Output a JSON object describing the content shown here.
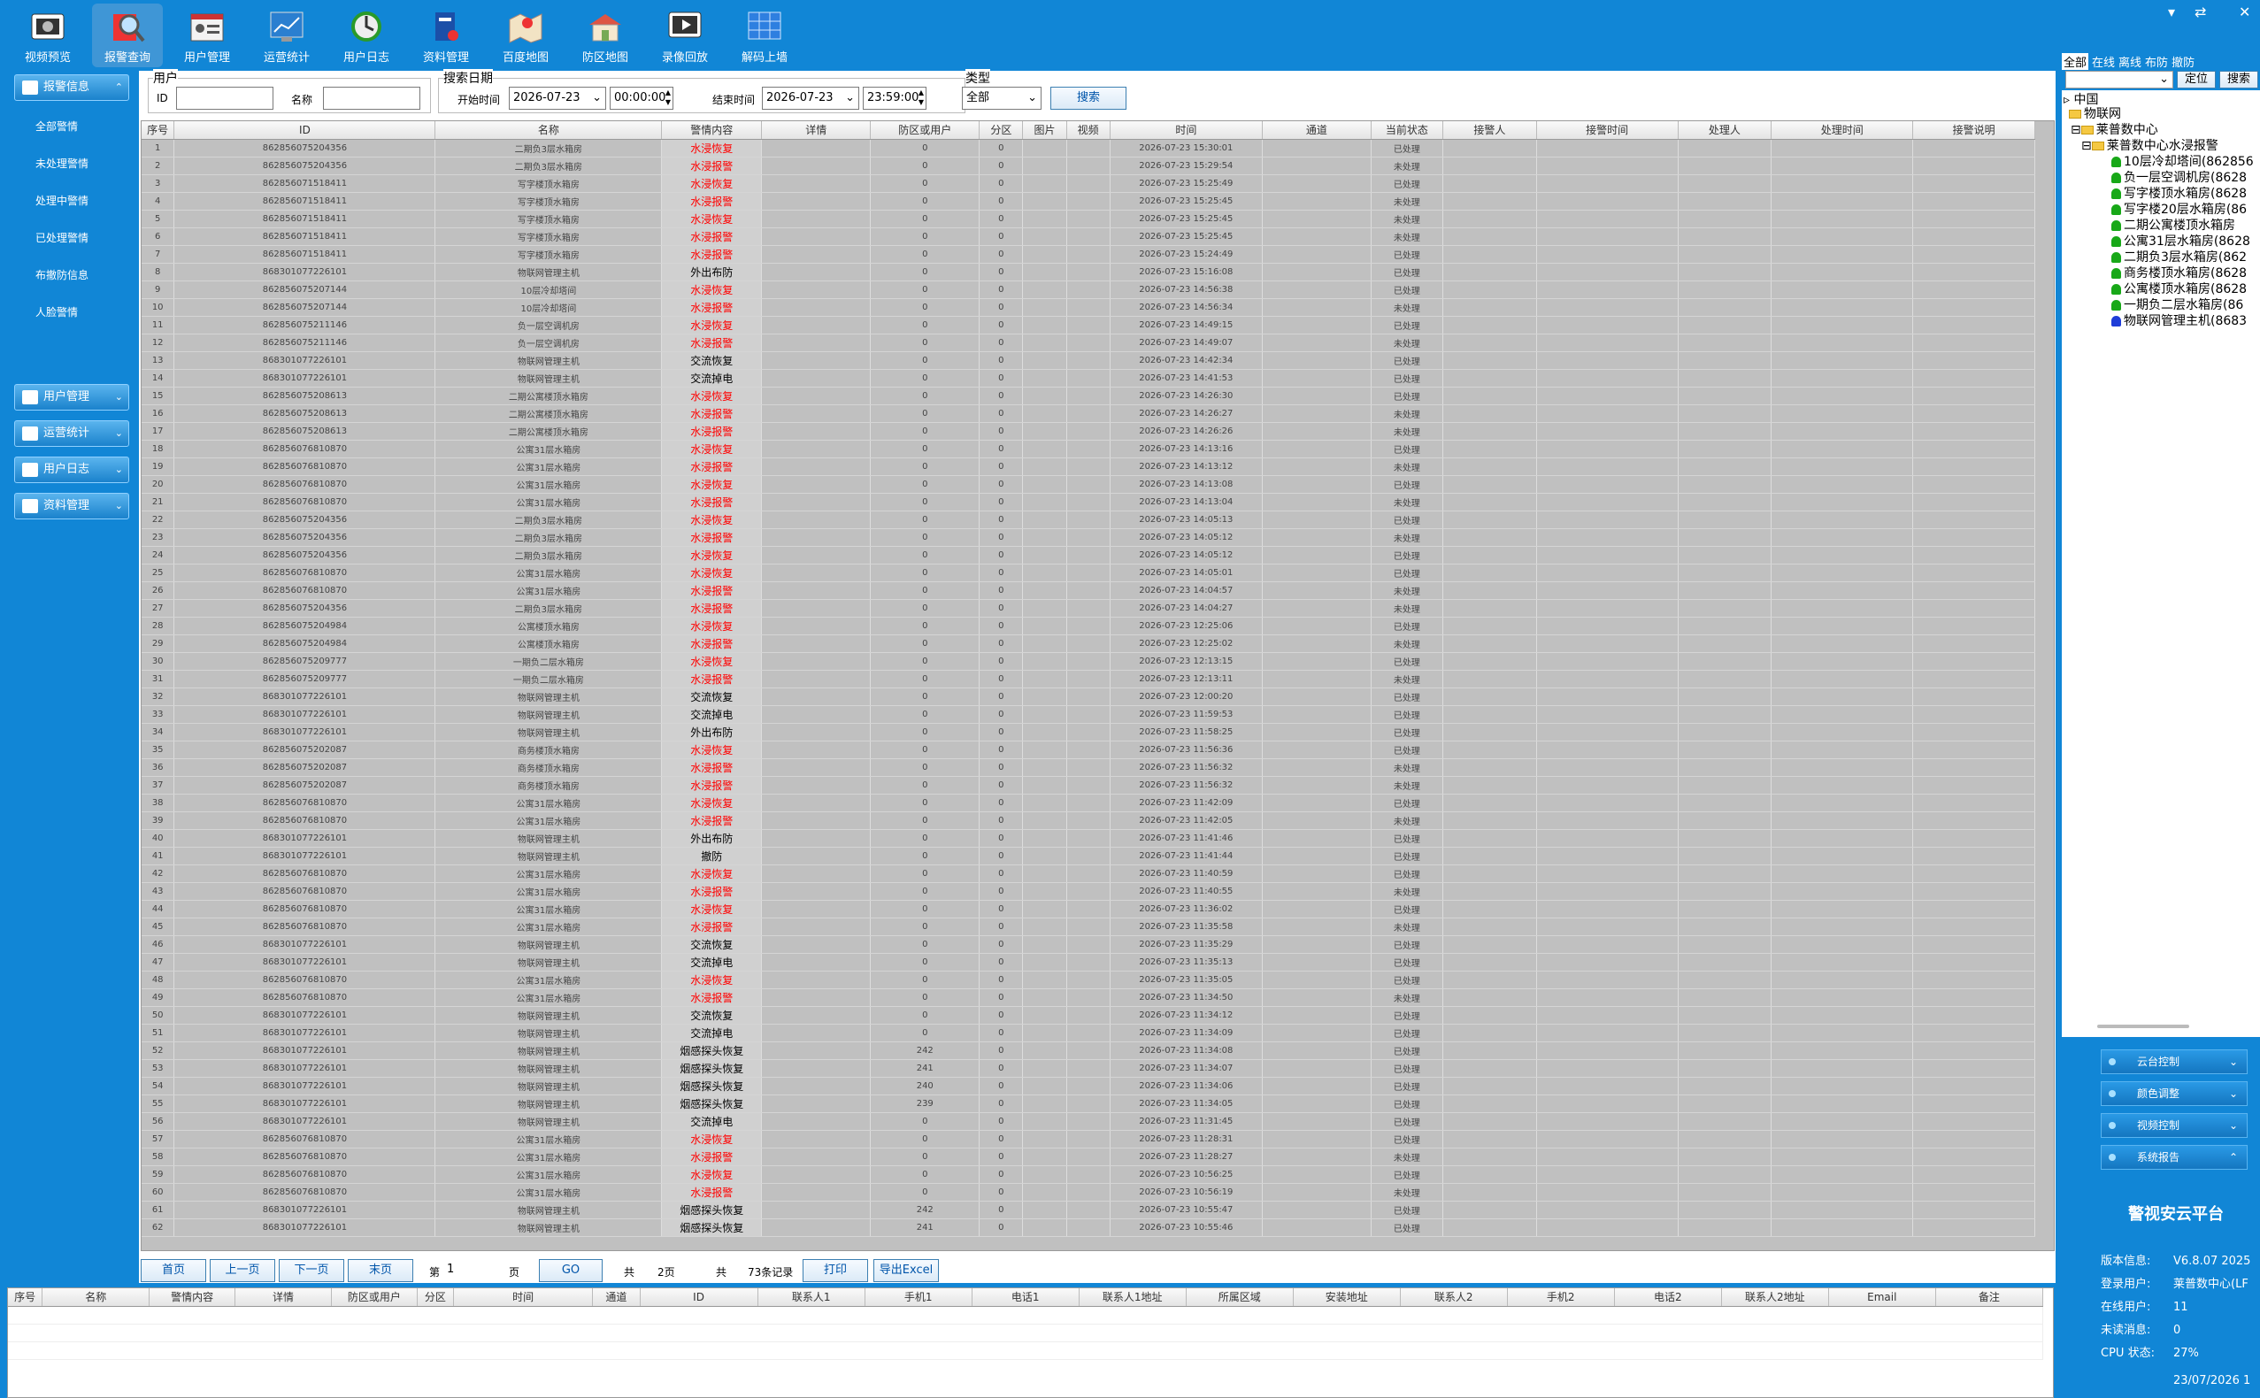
{
  "toolbar": {
    "items": [
      {
        "label": "视频预览",
        "icon": "video-preview-icon"
      },
      {
        "label": "报警查询",
        "icon": "alarm-query-icon"
      },
      {
        "label": "用户管理",
        "icon": "user-manage-icon"
      },
      {
        "label": "运营统计",
        "icon": "stats-icon"
      },
      {
        "label": "用户日志",
        "icon": "user-log-icon"
      },
      {
        "label": "资料管理",
        "icon": "data-manage-icon"
      },
      {
        "label": "百度地图",
        "icon": "baidu-map-icon"
      },
      {
        "label": "防区地图",
        "icon": "zone-map-icon"
      },
      {
        "label": "录像回放",
        "icon": "playback-icon"
      },
      {
        "label": "解码上墙",
        "icon": "decode-wall-icon"
      }
    ],
    "window_controls": [
      "▾",
      "⇄",
      "✕"
    ]
  },
  "leftnav": {
    "alarm_group": "报警信息",
    "alarm_items": [
      "全部警情",
      "未处理警情",
      "处理中警情",
      "已处理警情",
      "布撤防信息",
      "人脸警情"
    ],
    "groups": [
      "用户管理",
      "运营统计",
      "用户日志",
      "资料管理"
    ]
  },
  "filter": {
    "user_legend": "用户",
    "id_label": "ID",
    "name_label": "名称",
    "date_legend": "搜索日期",
    "start_label": "开始时间",
    "start_date": "2026-07-23",
    "start_time": "00:00:00",
    "end_label": "结束时间",
    "end_date": "2026-07-23",
    "end_time": "23:59:00",
    "type_legend": "类型",
    "type_value": "全部",
    "search_button": "搜索"
  },
  "grid": {
    "columns": [
      "序号",
      "ID",
      "名称",
      "警情内容",
      "详情",
      "防区或用户",
      "分区",
      "图片",
      "视频",
      "时间",
      "通道",
      "当前状态",
      "接警人",
      "接警时间",
      "处理人",
      "处理时间",
      "接警说明"
    ],
    "rows": [
      [
        "1",
        "862856075204356",
        "二期负3层水箱房",
        "水浸恢复",
        "",
        "0",
        "0",
        "",
        "",
        "2026-07-23 15:30:01",
        "",
        "已处理"
      ],
      [
        "2",
        "862856075204356",
        "二期负3层水箱房",
        "水浸报警",
        "",
        "0",
        "0",
        "",
        "",
        "2026-07-23 15:29:54",
        "",
        "未处理"
      ],
      [
        "3",
        "862856071518411",
        "写字楼顶水箱房",
        "水浸恢复",
        "",
        "0",
        "0",
        "",
        "",
        "2026-07-23 15:25:49",
        "",
        "已处理"
      ],
      [
        "4",
        "862856071518411",
        "写字楼顶水箱房",
        "水浸报警",
        "",
        "0",
        "0",
        "",
        "",
        "2026-07-23 15:25:45",
        "",
        "未处理"
      ],
      [
        "5",
        "862856071518411",
        "写字楼顶水箱房",
        "水浸恢复",
        "",
        "0",
        "0",
        "",
        "",
        "2026-07-23 15:25:45",
        "",
        "未处理"
      ],
      [
        "6",
        "862856071518411",
        "写字楼顶水箱房",
        "水浸报警",
        "",
        "0",
        "0",
        "",
        "",
        "2026-07-23 15:25:45",
        "",
        "未处理"
      ],
      [
        "7",
        "862856071518411",
        "写字楼顶水箱房",
        "水浸报警",
        "",
        "0",
        "0",
        "",
        "",
        "2026-07-23 15:24:49",
        "",
        "已处理"
      ],
      [
        "8",
        "868301077226101",
        "物联网管理主机",
        "外出布防",
        "",
        "0",
        "0",
        "",
        "",
        "2026-07-23 15:16:08",
        "",
        "已处理"
      ],
      [
        "9",
        "862856075207144",
        "10层冷却塔间",
        "水浸恢复",
        "",
        "0",
        "0",
        "",
        "",
        "2026-07-23 14:56:38",
        "",
        "已处理"
      ],
      [
        "10",
        "862856075207144",
        "10层冷却塔间",
        "水浸报警",
        "",
        "0",
        "0",
        "",
        "",
        "2026-07-23 14:56:34",
        "",
        "未处理"
      ],
      [
        "11",
        "862856075211146",
        "负一层空调机房",
        "水浸恢复",
        "",
        "0",
        "0",
        "",
        "",
        "2026-07-23 14:49:15",
        "",
        "已处理"
      ],
      [
        "12",
        "862856075211146",
        "负一层空调机房",
        "水浸报警",
        "",
        "0",
        "0",
        "",
        "",
        "2026-07-23 14:49:07",
        "",
        "未处理"
      ],
      [
        "13",
        "868301077226101",
        "物联网管理主机",
        "交流恢复",
        "",
        "0",
        "0",
        "",
        "",
        "2026-07-23 14:42:34",
        "",
        "已处理"
      ],
      [
        "14",
        "868301077226101",
        "物联网管理主机",
        "交流掉电",
        "",
        "0",
        "0",
        "",
        "",
        "2026-07-23 14:41:53",
        "",
        "已处理"
      ],
      [
        "15",
        "862856075208613",
        "二期公寓楼顶水箱房",
        "水浸恢复",
        "",
        "0",
        "0",
        "",
        "",
        "2026-07-23 14:26:30",
        "",
        "已处理"
      ],
      [
        "16",
        "862856075208613",
        "二期公寓楼顶水箱房",
        "水浸报警",
        "",
        "0",
        "0",
        "",
        "",
        "2026-07-23 14:26:27",
        "",
        "未处理"
      ],
      [
        "17",
        "862856075208613",
        "二期公寓楼顶水箱房",
        "水浸报警",
        "",
        "0",
        "0",
        "",
        "",
        "2026-07-23 14:26:26",
        "",
        "未处理"
      ],
      [
        "18",
        "862856076810870",
        "公寓31层水箱房",
        "水浸恢复",
        "",
        "0",
        "0",
        "",
        "",
        "2026-07-23 14:13:16",
        "",
        "已处理"
      ],
      [
        "19",
        "862856076810870",
        "公寓31层水箱房",
        "水浸报警",
        "",
        "0",
        "0",
        "",
        "",
        "2026-07-23 14:13:12",
        "",
        "未处理"
      ],
      [
        "20",
        "862856076810870",
        "公寓31层水箱房",
        "水浸恢复",
        "",
        "0",
        "0",
        "",
        "",
        "2026-07-23 14:13:08",
        "",
        "已处理"
      ],
      [
        "21",
        "862856076810870",
        "公寓31层水箱房",
        "水浸报警",
        "",
        "0",
        "0",
        "",
        "",
        "2026-07-23 14:13:04",
        "",
        "未处理"
      ],
      [
        "22",
        "862856075204356",
        "二期负3层水箱房",
        "水浸恢复",
        "",
        "0",
        "0",
        "",
        "",
        "2026-07-23 14:05:13",
        "",
        "已处理"
      ],
      [
        "23",
        "862856075204356",
        "二期负3层水箱房",
        "水浸报警",
        "",
        "0",
        "0",
        "",
        "",
        "2026-07-23 14:05:12",
        "",
        "未处理"
      ],
      [
        "24",
        "862856075204356",
        "二期负3层水箱房",
        "水浸恢复",
        "",
        "0",
        "0",
        "",
        "",
        "2026-07-23 14:05:12",
        "",
        "已处理"
      ],
      [
        "25",
        "862856076810870",
        "公寓31层水箱房",
        "水浸恢复",
        "",
        "0",
        "0",
        "",
        "",
        "2026-07-23 14:05:01",
        "",
        "已处理"
      ],
      [
        "26",
        "862856076810870",
        "公寓31层水箱房",
        "水浸报警",
        "",
        "0",
        "0",
        "",
        "",
        "2026-07-23 14:04:57",
        "",
        "未处理"
      ],
      [
        "27",
        "862856075204356",
        "二期负3层水箱房",
        "水浸报警",
        "",
        "0",
        "0",
        "",
        "",
        "2026-07-23 14:04:27",
        "",
        "未处理"
      ],
      [
        "28",
        "862856075204984",
        "公寓楼顶水箱房",
        "水浸恢复",
        "",
        "0",
        "0",
        "",
        "",
        "2026-07-23 12:25:06",
        "",
        "已处理"
      ],
      [
        "29",
        "862856075204984",
        "公寓楼顶水箱房",
        "水浸报警",
        "",
        "0",
        "0",
        "",
        "",
        "2026-07-23 12:25:02",
        "",
        "未处理"
      ],
      [
        "30",
        "862856075209777",
        "一期负二层水箱房",
        "水浸恢复",
        "",
        "0",
        "0",
        "",
        "",
        "2026-07-23 12:13:15",
        "",
        "已处理"
      ],
      [
        "31",
        "862856075209777",
        "一期负二层水箱房",
        "水浸报警",
        "",
        "0",
        "0",
        "",
        "",
        "2026-07-23 12:13:11",
        "",
        "未处理"
      ],
      [
        "32",
        "868301077226101",
        "物联网管理主机",
        "交流恢复",
        "",
        "0",
        "0",
        "",
        "",
        "2026-07-23 12:00:20",
        "",
        "已处理"
      ],
      [
        "33",
        "868301077226101",
        "物联网管理主机",
        "交流掉电",
        "",
        "0",
        "0",
        "",
        "",
        "2026-07-23 11:59:53",
        "",
        "已处理"
      ],
      [
        "34",
        "868301077226101",
        "物联网管理主机",
        "外出布防",
        "",
        "0",
        "0",
        "",
        "",
        "2026-07-23 11:58:25",
        "",
        "已处理"
      ],
      [
        "35",
        "862856075202087",
        "商务楼顶水箱房",
        "水浸恢复",
        "",
        "0",
        "0",
        "",
        "",
        "2026-07-23 11:56:36",
        "",
        "已处理"
      ],
      [
        "36",
        "862856075202087",
        "商务楼顶水箱房",
        "水浸报警",
        "",
        "0",
        "0",
        "",
        "",
        "2026-07-23 11:56:32",
        "",
        "未处理"
      ],
      [
        "37",
        "862856075202087",
        "商务楼顶水箱房",
        "水浸报警",
        "",
        "0",
        "0",
        "",
        "",
        "2026-07-23 11:56:32",
        "",
        "未处理"
      ],
      [
        "38",
        "862856076810870",
        "公寓31层水箱房",
        "水浸恢复",
        "",
        "0",
        "0",
        "",
        "",
        "2026-07-23 11:42:09",
        "",
        "已处理"
      ],
      [
        "39",
        "862856076810870",
        "公寓31层水箱房",
        "水浸报警",
        "",
        "0",
        "0",
        "",
        "",
        "2026-07-23 11:42:05",
        "",
        "未处理"
      ],
      [
        "40",
        "868301077226101",
        "物联网管理主机",
        "外出布防",
        "",
        "0",
        "0",
        "",
        "",
        "2026-07-23 11:41:46",
        "",
        "已处理"
      ],
      [
        "41",
        "868301077226101",
        "物联网管理主机",
        "撤防",
        "",
        "0",
        "0",
        "",
        "",
        "2026-07-23 11:41:44",
        "",
        "已处理"
      ],
      [
        "42",
        "862856076810870",
        "公寓31层水箱房",
        "水浸恢复",
        "",
        "0",
        "0",
        "",
        "",
        "2026-07-23 11:40:59",
        "",
        "已处理"
      ],
      [
        "43",
        "862856076810870",
        "公寓31层水箱房",
        "水浸报警",
        "",
        "0",
        "0",
        "",
        "",
        "2026-07-23 11:40:55",
        "",
        "未处理"
      ],
      [
        "44",
        "862856076810870",
        "公寓31层水箱房",
        "水浸恢复",
        "",
        "0",
        "0",
        "",
        "",
        "2026-07-23 11:36:02",
        "",
        "已处理"
      ],
      [
        "45",
        "862856076810870",
        "公寓31层水箱房",
        "水浸报警",
        "",
        "0",
        "0",
        "",
        "",
        "2026-07-23 11:35:58",
        "",
        "未处理"
      ],
      [
        "46",
        "868301077226101",
        "物联网管理主机",
        "交流恢复",
        "",
        "0",
        "0",
        "",
        "",
        "2026-07-23 11:35:29",
        "",
        "已处理"
      ],
      [
        "47",
        "868301077226101",
        "物联网管理主机",
        "交流掉电",
        "",
        "0",
        "0",
        "",
        "",
        "2026-07-23 11:35:13",
        "",
        "已处理"
      ],
      [
        "48",
        "862856076810870",
        "公寓31层水箱房",
        "水浸恢复",
        "",
        "0",
        "0",
        "",
        "",
        "2026-07-23 11:35:05",
        "",
        "已处理"
      ],
      [
        "49",
        "862856076810870",
        "公寓31层水箱房",
        "水浸报警",
        "",
        "0",
        "0",
        "",
        "",
        "2026-07-23 11:34:50",
        "",
        "未处理"
      ],
      [
        "50",
        "868301077226101",
        "物联网管理主机",
        "交流恢复",
        "",
        "0",
        "0",
        "",
        "",
        "2026-07-23 11:34:12",
        "",
        "已处理"
      ],
      [
        "51",
        "868301077226101",
        "物联网管理主机",
        "交流掉电",
        "",
        "0",
        "0",
        "",
        "",
        "2026-07-23 11:34:09",
        "",
        "已处理"
      ],
      [
        "52",
        "868301077226101",
        "物联网管理主机",
        "烟感探头恢复",
        "",
        "242",
        "0",
        "",
        "",
        "2026-07-23 11:34:08",
        "",
        "已处理"
      ],
      [
        "53",
        "868301077226101",
        "物联网管理主机",
        "烟感探头恢复",
        "",
        "241",
        "0",
        "",
        "",
        "2026-07-23 11:34:07",
        "",
        "已处理"
      ],
      [
        "54",
        "868301077226101",
        "物联网管理主机",
        "烟感探头恢复",
        "",
        "240",
        "0",
        "",
        "",
        "2026-07-23 11:34:06",
        "",
        "已处理"
      ],
      [
        "55",
        "868301077226101",
        "物联网管理主机",
        "烟感探头恢复",
        "",
        "239",
        "0",
        "",
        "",
        "2026-07-23 11:34:05",
        "",
        "已处理"
      ],
      [
        "56",
        "868301077226101",
        "物联网管理主机",
        "交流掉电",
        "",
        "0",
        "0",
        "",
        "",
        "2026-07-23 11:31:45",
        "",
        "已处理"
      ],
      [
        "57",
        "862856076810870",
        "公寓31层水箱房",
        "水浸恢复",
        "",
        "0",
        "0",
        "",
        "",
        "2026-07-23 11:28:31",
        "",
        "已处理"
      ],
      [
        "58",
        "862856076810870",
        "公寓31层水箱房",
        "水浸报警",
        "",
        "0",
        "0",
        "",
        "",
        "2026-07-23 11:28:27",
        "",
        "未处理"
      ],
      [
        "59",
        "862856076810870",
        "公寓31层水箱房",
        "水浸恢复",
        "",
        "0",
        "0",
        "",
        "",
        "2026-07-23 10:56:25",
        "",
        "已处理"
      ],
      [
        "60",
        "862856076810870",
        "公寓31层水箱房",
        "水浸报警",
        "",
        "0",
        "0",
        "",
        "",
        "2026-07-23 10:56:19",
        "",
        "未处理"
      ],
      [
        "61",
        "868301077226101",
        "物联网管理主机",
        "烟感探头恢复",
        "",
        "242",
        "0",
        "",
        "",
        "2026-07-23 10:55:47",
        "",
        "已处理"
      ],
      [
        "62",
        "868301077226101",
        "物联网管理主机",
        "烟感探头恢复",
        "",
        "241",
        "0",
        "",
        "",
        "2026-07-23 10:55:46",
        "",
        "已处理"
      ]
    ]
  },
  "pager": {
    "first": "首页",
    "prev": "上一页",
    "next": "下一页",
    "last": "末页",
    "page_prefix": "第",
    "page_value": "1",
    "page_suffix": "页",
    "go": "GO",
    "total_label": "共",
    "total_pages": "2页",
    "records_label": "共",
    "records": "73条记录",
    "print": "打印",
    "export": "导出Excel"
  },
  "bottom": {
    "columns": [
      "序号",
      "名称",
      "警情内容",
      "详情",
      "防区或用户",
      "分区",
      "时间",
      "通道",
      "ID",
      "联系人1",
      "手机1",
      "电话1",
      "联系人1地址",
      "所属区域",
      "安装地址",
      "联系人2",
      "手机2",
      "电话2",
      "联系人2地址",
      "Email",
      "备注"
    ]
  },
  "right": {
    "tabs": [
      "全部",
      "在线",
      "离线",
      "布防",
      "撤防"
    ],
    "locate_button": "定位",
    "search_button": "搜索",
    "tree": {
      "root": "中国",
      "l1": "物联网",
      "l2": "莱普数中心",
      "l3": "莱普数中心水浸报警",
      "leaves": [
        "10层冷却塔间(862856",
        "负一层空调机房(8628",
        "写字楼顶水箱房(8628",
        "写字楼20层水箱房(86",
        "二期公寓楼顶水箱房",
        "公寓31层水箱房(8628",
        "二期负3层水箱房(862",
        "商务楼顶水箱房(8628",
        "公寓楼顶水箱房(8628",
        "一期负二层水箱房(86",
        "物联网管理主机(8683"
      ]
    },
    "controls": [
      "云台控制",
      "颜色调整",
      "视频控制",
      "系统报告"
    ],
    "platform_title": "警视安云平台",
    "info": [
      {
        "label": "版本信息:",
        "value": "V6.8.07 2025"
      },
      {
        "label": "登录用户:",
        "value": "莱普数中心(LF"
      },
      {
        "label": "在线用户:",
        "value": "11"
      },
      {
        "label": "未读消息:",
        "value": "0"
      },
      {
        "label": "CPU 状态:",
        "value": "27%"
      }
    ],
    "datetime": "23/07/2026 1"
  },
  "colors": {
    "background": "#1186d6",
    "alarm_text": "#ff0000",
    "grid_body": "#c0c0c0"
  }
}
